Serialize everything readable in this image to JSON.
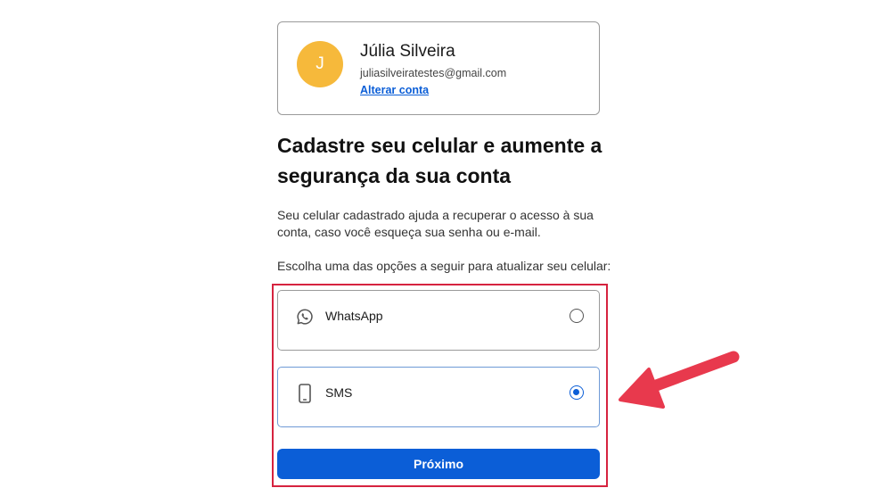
{
  "account": {
    "avatar_initial": "J",
    "name": "Júlia Silveira",
    "email": "juliasilveiratestes@gmail.com",
    "change_account_link": "Alterar conta",
    "avatar_color": "#f6b93b"
  },
  "heading": "Cadastre seu celular e aumente a segurança da sua conta",
  "description": "Seu celular cadastrado ajuda a recuperar o acesso à sua conta, caso você esqueça sua senha ou e-mail.",
  "prompt": "Escolha uma das opções a seguir para atualizar seu celular:",
  "options": [
    {
      "label": "WhatsApp",
      "icon": "whatsapp-icon",
      "selected": false
    },
    {
      "label": "SMS",
      "icon": "phone-icon",
      "selected": true
    }
  ],
  "next_button_label": "Próximo",
  "colors": {
    "primary": "#0b5ed7",
    "highlight_annotation": "#d6233f"
  }
}
